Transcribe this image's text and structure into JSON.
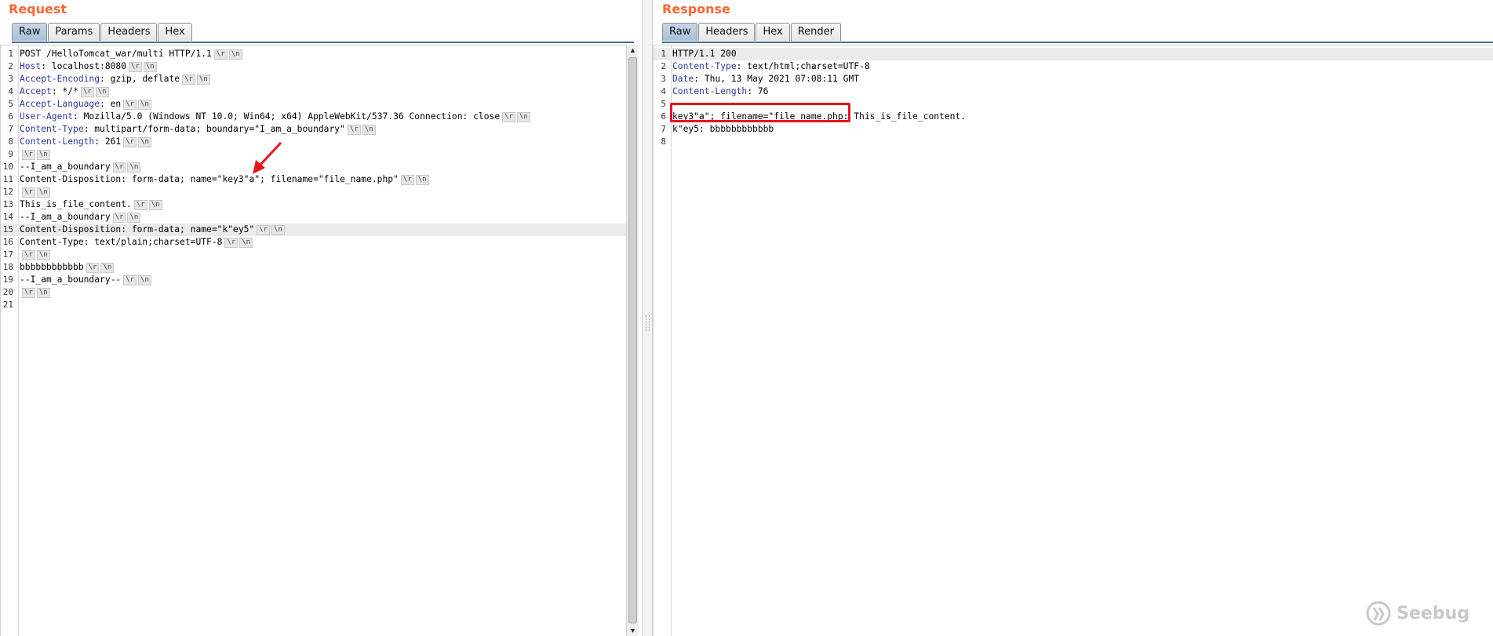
{
  "request": {
    "title": "Request",
    "tabs": [
      {
        "label": "Raw",
        "active": true
      },
      {
        "label": "Params",
        "active": false
      },
      {
        "label": "Headers",
        "active": false
      },
      {
        "label": "Hex",
        "active": false
      }
    ],
    "crlf_marker": [
      "\\r",
      "\\n"
    ],
    "lines": [
      {
        "num": "1",
        "name": "",
        "text": "POST /HelloTomcat_war/multi HTTP/1.1",
        "crlf": true
      },
      {
        "num": "2",
        "name": "Host",
        "text": ": localhost:8080",
        "crlf": true
      },
      {
        "num": "3",
        "name": "Accept-Encoding",
        "text": ": gzip, deflate",
        "crlf": true
      },
      {
        "num": "4",
        "name": "Accept",
        "text": ": */*",
        "crlf": true
      },
      {
        "num": "5",
        "name": "Accept-Language",
        "text": ": en",
        "crlf": true
      },
      {
        "num": "6",
        "name": "User-Agent",
        "text": ": Mozilla/5.0 (Windows NT 10.0; Win64; x64) AppleWebKit/537.36 Connection: close",
        "crlf": true
      },
      {
        "num": "7",
        "name": "Content-Type",
        "text": ": multipart/form-data; boundary=\"I_am_a_boundary\"",
        "crlf": true
      },
      {
        "num": "8",
        "name": "Content-Length",
        "text": ": 261",
        "crlf": true
      },
      {
        "num": "9",
        "name": "",
        "text": "",
        "crlf": true
      },
      {
        "num": "10",
        "name": "",
        "text": "--I_am_a_boundary",
        "crlf": true
      },
      {
        "num": "11",
        "name": "",
        "text": "Content-Disposition: form-data; name=\"key3\"a\"; filename=\"file_name.php\"",
        "crlf": true
      },
      {
        "num": "12",
        "name": "",
        "text": "",
        "crlf": true
      },
      {
        "num": "13",
        "name": "",
        "text": "This_is_file_content.",
        "crlf": true
      },
      {
        "num": "14",
        "name": "",
        "text": "--I_am_a_boundary",
        "crlf": true
      },
      {
        "num": "15",
        "name": "",
        "text": "Content-Disposition: form-data; name=\"k\"ey5\"",
        "crlf": true,
        "highlight": true
      },
      {
        "num": "16",
        "name": "",
        "text": "Content-Type: text/plain;charset=UTF-8",
        "crlf": true
      },
      {
        "num": "17",
        "name": "",
        "text": "",
        "crlf": true
      },
      {
        "num": "18",
        "name": "",
        "text": "bbbbbbbbbbbb",
        "crlf": true
      },
      {
        "num": "19",
        "name": "",
        "text": "--I_am_a_boundary--",
        "crlf": true
      },
      {
        "num": "20",
        "name": "",
        "text": "",
        "crlf": true
      },
      {
        "num": "21",
        "name": "",
        "text": "",
        "crlf": false
      }
    ]
  },
  "response": {
    "title": "Response",
    "tabs": [
      {
        "label": "Raw",
        "active": true
      },
      {
        "label": "Headers",
        "active": false
      },
      {
        "label": "Hex",
        "active": false
      },
      {
        "label": "Render",
        "active": false
      }
    ],
    "lines": [
      {
        "num": "1",
        "name": "",
        "text": "HTTP/1.1 200",
        "highlight": true
      },
      {
        "num": "2",
        "name": "Content-Type",
        "text": ": text/html;charset=UTF-8"
      },
      {
        "num": "3",
        "name": "Date",
        "text": ": Thu, 13 May 2021 07:08:11 GMT"
      },
      {
        "num": "4",
        "name": "Content-Length",
        "text": ": 76"
      },
      {
        "num": "5",
        "name": "",
        "text": ""
      },
      {
        "num": "6",
        "name": "",
        "text": "key3\"a\"; filename=\"file_name.php: This_is_file_content."
      },
      {
        "num": "7",
        "name": "",
        "text": "k\"ey5: bbbbbbbbbbbb"
      },
      {
        "num": "8",
        "name": "",
        "text": ""
      }
    ]
  },
  "watermark": "Seebug",
  "colors": {
    "title": "#ff6633",
    "header_name": "#2b3a9c",
    "annotation": "#e8141d"
  }
}
